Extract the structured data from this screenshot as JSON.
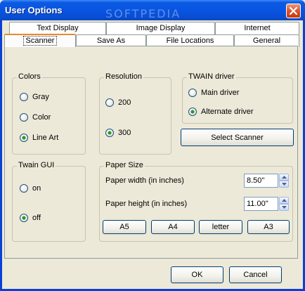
{
  "window": {
    "title": "User Options",
    "watermark": "SOFTPEDIA"
  },
  "tabs_row1": [
    {
      "label": "Text Display"
    },
    {
      "label": "Image Display"
    },
    {
      "label": "Internet"
    }
  ],
  "tabs_row2": [
    {
      "label": "Scanner",
      "active": true
    },
    {
      "label": "Save As"
    },
    {
      "label": "File Locations"
    },
    {
      "label": "General"
    }
  ],
  "colors": {
    "title": "Colors",
    "options": [
      {
        "label": "Gray",
        "checked": false
      },
      {
        "label": "Color",
        "checked": false
      },
      {
        "label": "Line Art",
        "checked": true
      }
    ]
  },
  "resolution": {
    "title": "Resolution",
    "options": [
      {
        "label": "200",
        "checked": false
      },
      {
        "label": "300",
        "checked": true
      }
    ]
  },
  "twain_driver": {
    "title": "TWAIN driver",
    "options": [
      {
        "label": "Main driver",
        "checked": false
      },
      {
        "label": "Alternate driver",
        "checked": true
      }
    ],
    "select_scanner_label": "Select Scanner"
  },
  "twain_gui": {
    "title": "Twain GUI",
    "options": [
      {
        "label": "on",
        "checked": false
      },
      {
        "label": "off",
        "checked": true
      }
    ]
  },
  "paper_size": {
    "title": "Paper Size",
    "width_label": "Paper width (in inches)",
    "width_value": "8.50''",
    "height_label": "Paper height (in inches)",
    "height_value": "11.00''",
    "presets": [
      "A5",
      "A4",
      "letter",
      "A3"
    ]
  },
  "footer": {
    "ok_label": "OK",
    "cancel_label": "Cancel"
  },
  "colors_theme": {
    "titlebar": "#0854e0",
    "face": "#ece9d8",
    "radio_dot": "#21a121",
    "active_tab": "#e68b2c"
  }
}
